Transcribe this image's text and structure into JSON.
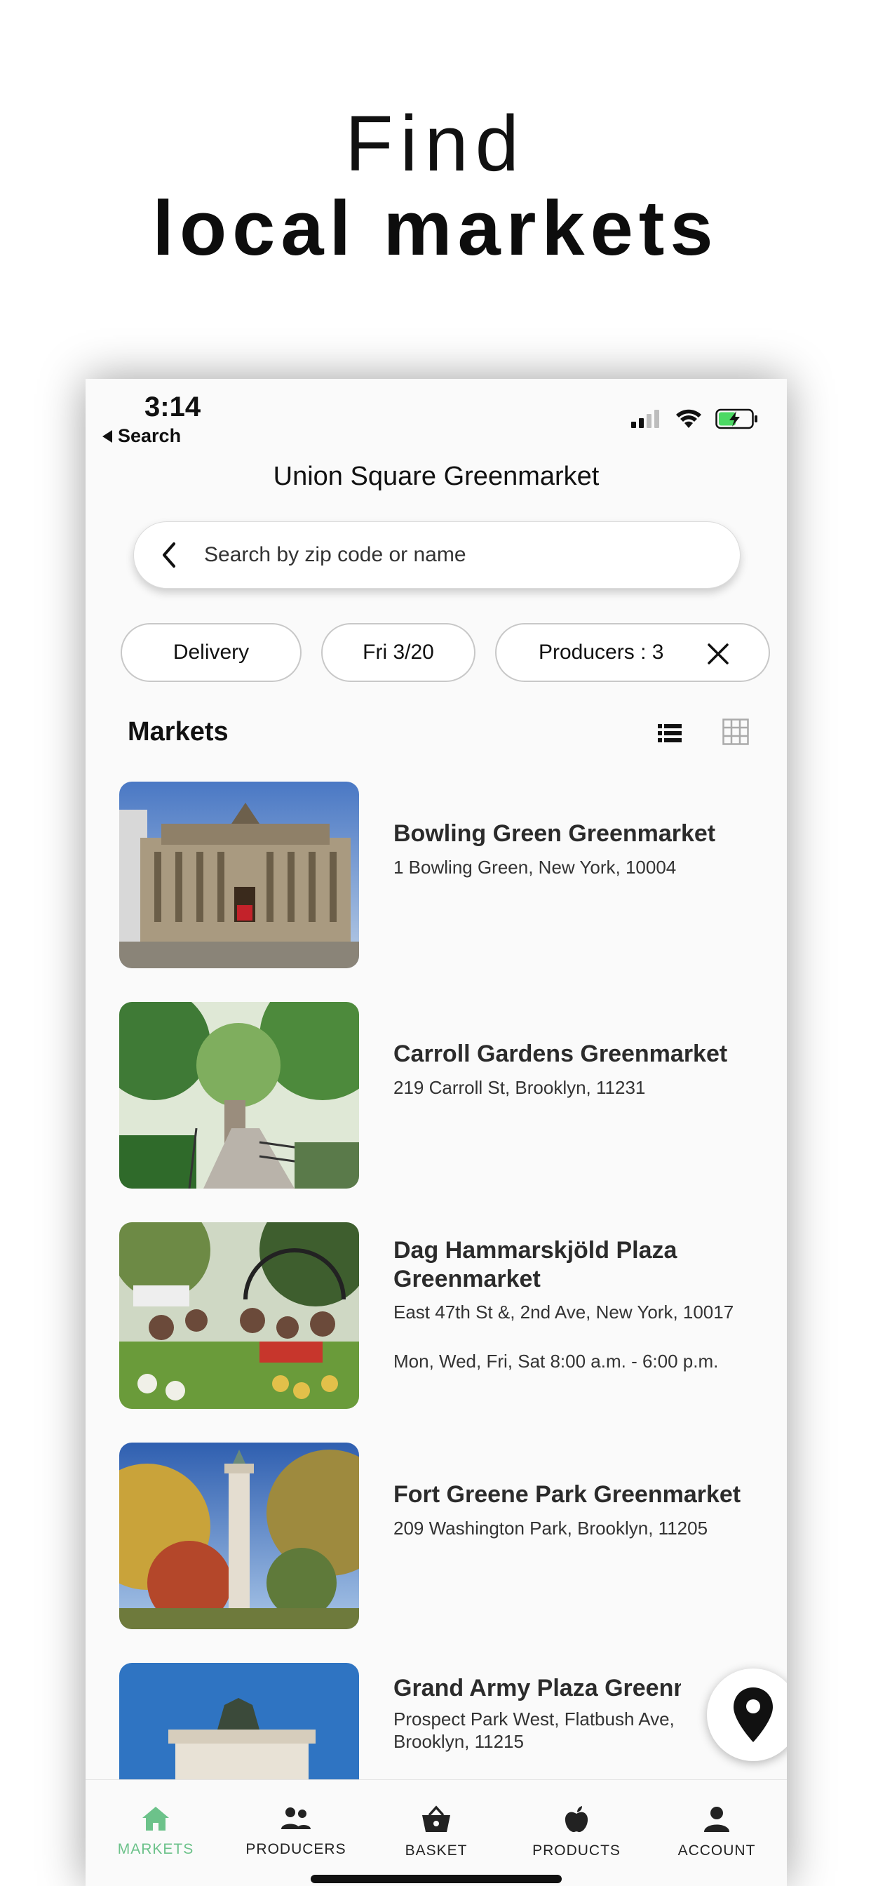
{
  "promo": {
    "line1": "Find",
    "line2": "local markets"
  },
  "status_bar": {
    "time": "3:14",
    "back_label": "Search",
    "icons": [
      "signal-icon",
      "wifi-icon",
      "battery-charging-icon"
    ]
  },
  "screen": {
    "title": "Union Square Greenmarket"
  },
  "search": {
    "placeholder": "Search by zip code or name",
    "value": ""
  },
  "filters": [
    {
      "label": "Delivery"
    },
    {
      "label": "Fri 3/20"
    },
    {
      "label": "Producers : 3",
      "removable": true
    }
  ],
  "section": {
    "title": "Markets",
    "view_modes": [
      "list-view-icon",
      "grid-view-icon"
    ],
    "active_view": "list"
  },
  "markets": [
    {
      "name": "Bowling Green Greenmarket",
      "lines": [
        "1 Bowling Green, New York, 10004"
      ]
    },
    {
      "name": "Carroll Gardens Greenmarket",
      "lines": [
        "219 Carroll St, Brooklyn, 11231"
      ]
    },
    {
      "name": "Dag Hammarskjöld Plaza Greenmarket",
      "lines": [
        "East 47th St &, 2nd Ave,  New York, 10017",
        "Mon, Wed, Fri, Sat 8:00 a.m. - 6:00 p.m."
      ]
    },
    {
      "name": "Fort Greene Park Greenmarket",
      "lines": [
        "209 Washington Park, Brooklyn, 11205"
      ]
    },
    {
      "name": "Grand Army Plaza Greenmarket",
      "lines": [
        " Prospect Park West, Flatbush Ave, Brooklyn, 11215"
      ]
    }
  ],
  "tabs": [
    {
      "label": "MARKETS",
      "icon": "home-icon",
      "active": true
    },
    {
      "label": "PRODUCERS",
      "icon": "people-icon",
      "active": false
    },
    {
      "label": "BASKET",
      "icon": "basket-icon",
      "active": false
    },
    {
      "label": "PRODUCTS",
      "icon": "apple-icon",
      "active": false
    },
    {
      "label": "ACCOUNT",
      "icon": "person-icon",
      "active": false
    }
  ],
  "colors": {
    "accent": "#6cc28a",
    "text": "#111111",
    "chip_border": "#c8c8c8"
  }
}
